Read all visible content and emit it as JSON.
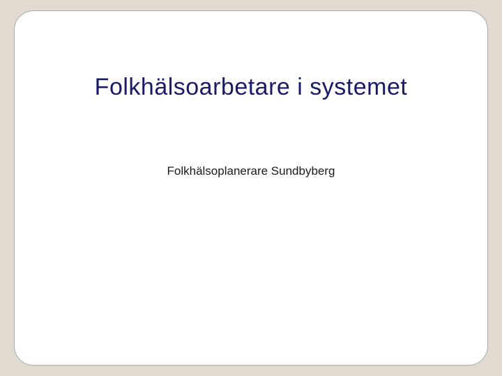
{
  "slide": {
    "title": "Folkhälsoarbetare i systemet",
    "subtitle": "Folkhälsoplanerare Sundbyberg"
  }
}
